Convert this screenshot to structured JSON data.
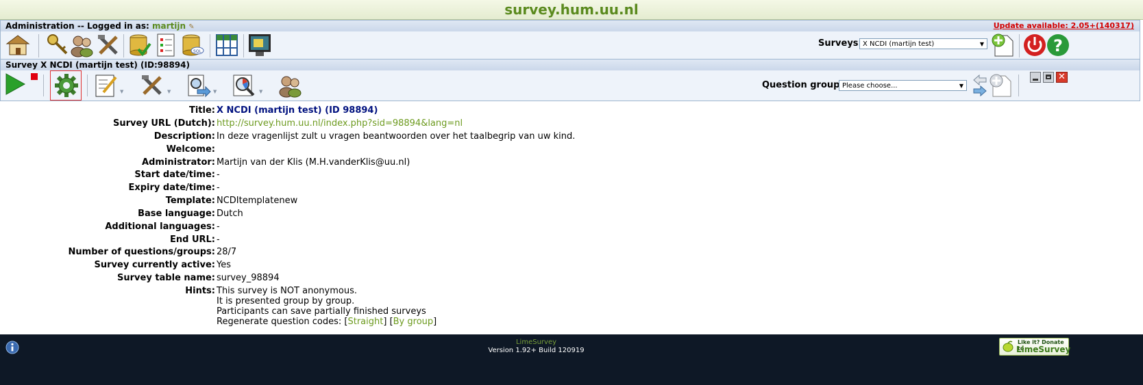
{
  "site": {
    "title": "survey.hum.uu.nl"
  },
  "admin_bar": {
    "title_prefix": "Administration -- Logged in as:",
    "username": "martijn",
    "update_text": "Update available: 2.05+(140317)",
    "icons": [
      "home-icon",
      "key-icon",
      "users-icon",
      "tools-icon",
      "db-check-icon",
      "checklist-icon",
      "sql-icon",
      "grid-icon",
      "display-icon"
    ],
    "surveys_label": "Surveys:",
    "surveys_selected": "X NCDI (martijn test)"
  },
  "survey_bar": {
    "title": "Survey X NCDI (martijn test) (ID:98894)",
    "question_groups_label": "Question groups:",
    "question_groups_placeholder": "Please choose..."
  },
  "details": [
    {
      "label": "Title:",
      "value": "X NCDI (martijn test) (ID 98894)"
    },
    {
      "label": "Survey URL (Dutch):",
      "value": "http://survey.hum.uu.nl/index.php?sid=98894&lang=nl"
    },
    {
      "label": "Description:",
      "value": "In deze vragenlijst zult u vragen beantwoorden over het taalbegrip van uw kind."
    },
    {
      "label": "Welcome:",
      "value": ""
    },
    {
      "label": "Administrator:",
      "value": "Martijn van der Klis (M.H.vanderKlis@uu.nl)"
    },
    {
      "label": "Start date/time:",
      "value": "-"
    },
    {
      "label": "Expiry date/time:",
      "value": "-"
    },
    {
      "label": "Template:",
      "value": "NCDItemplatenew"
    },
    {
      "label": "Base language:",
      "value": "Dutch"
    },
    {
      "label": "Additional languages:",
      "value": "-"
    },
    {
      "label": "End URL:",
      "value": "-"
    },
    {
      "label": "Number of questions/groups:",
      "value": "28/7"
    },
    {
      "label": "Survey currently active:",
      "value": "Yes"
    },
    {
      "label": "Survey table name:",
      "value": "survey_98894"
    }
  ],
  "hints": {
    "label": "Hints:",
    "lines": [
      "This survey is NOT anonymous.",
      "It is presented group by group.",
      "Participants can save partially finished surveys"
    ],
    "regen_prefix": "Regenerate question codes: [",
    "regen_straight": "Straight",
    "regen_mid": "] [",
    "regen_by_group": "By group",
    "regen_suffix": "]"
  },
  "footer": {
    "brand": "LimeSurvey",
    "version": "Version 1.92+ Build 120919",
    "donate_line1": "Like it? Donate to",
    "donate_line2": "LimeSurvey"
  }
}
